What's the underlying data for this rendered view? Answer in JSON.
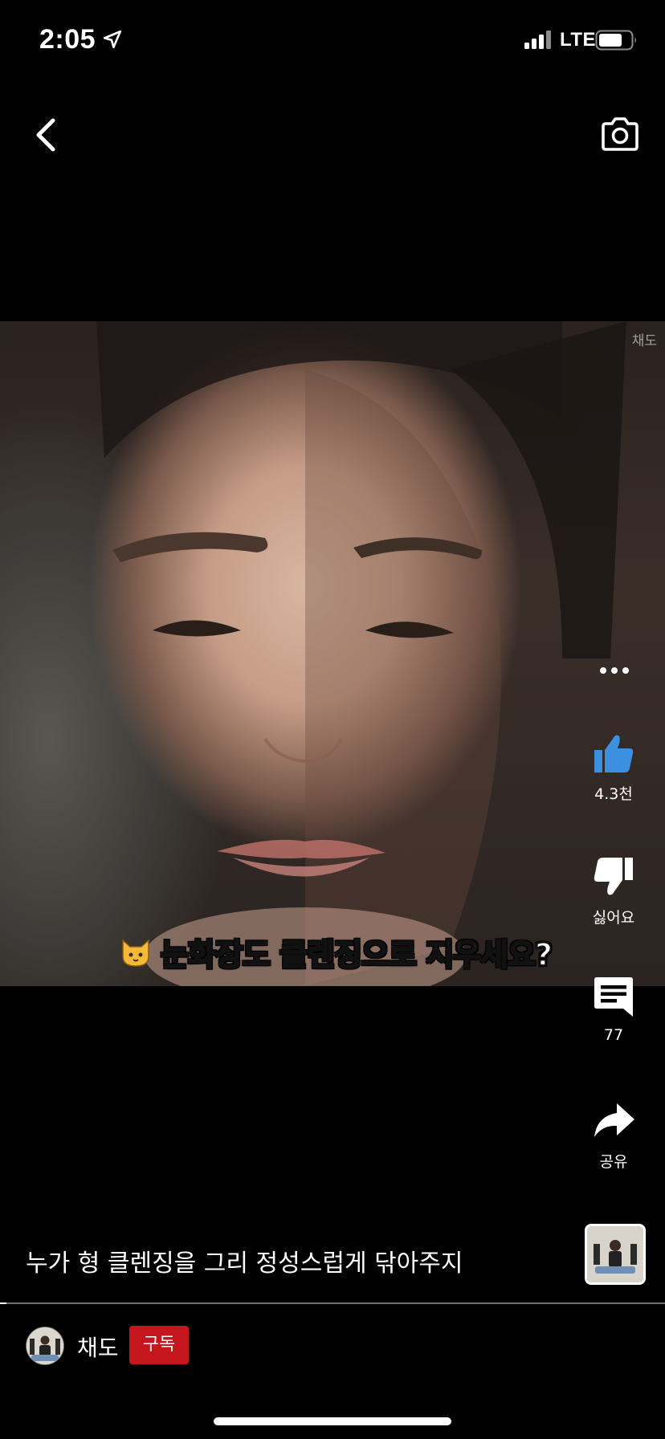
{
  "status_bar": {
    "time": "2:05",
    "network": "LTE",
    "location_icon": "location-arrow-icon",
    "signal_icon": "cellular-signal-icon",
    "battery_icon": "battery-icon"
  },
  "header": {
    "back_icon": "chevron-left-icon",
    "camera_icon": "camera-icon"
  },
  "video": {
    "watermark": "채도",
    "caption_emoji_icon": "cat-face-icon",
    "caption": "눈화장도 클렌징으로 지우세요?"
  },
  "actions": {
    "more_icon": "more-horizontal-icon",
    "like_icon": "thumbs-up-icon",
    "like_label": "4.3천",
    "dislike_icon": "thumbs-down-icon",
    "dislike_label": "싫어요",
    "comment_icon": "comment-icon",
    "comment_label": "77",
    "share_icon": "share-arrow-icon",
    "share_label": "공유"
  },
  "description": "누가 형 클렌징을 그리 정성스럽게 닦아주지",
  "progress": {
    "fraction": 0.01
  },
  "channel": {
    "name": "채도",
    "subscribe_label": "구독"
  },
  "colors": {
    "background": "#000000",
    "like_blue": "#3d8fe0",
    "subscribe_red": "#c4161c",
    "text": "#ffffff"
  }
}
